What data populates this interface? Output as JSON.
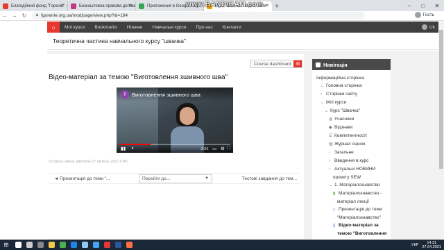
{
  "browser": {
    "tabs": [
      {
        "label": "Благодійний фонд \"Горєніє\" - Б",
        "favicon_color": "#e8372c"
      },
      {
        "label": "Безкоштовна правова допомога",
        "favicon_color": "#c13584"
      },
      {
        "label": "Приложения в Google Play – GE",
        "favicon_color": "#34a853"
      },
      {
        "label": "Курс \"Швачка\": Відео-мате",
        "favicon_color": "#f0a000",
        "active": true
      }
    ],
    "new_tab": "+",
    "url": "fgorenie.org.ua/mod/page/view.php?id=184",
    "profile": "Гость",
    "watermark": "www.BANDICAM.com"
  },
  "navbar": {
    "home_icon": "home-icon",
    "items": [
      "Мої курси",
      "Bookmarks",
      "Новини",
      "Навчальні курси",
      "Про нас",
      "Контакти"
    ],
    "lang": "Uk"
  },
  "page": {
    "header_title": "Теоретична частина навчального курсу \"швачка\"",
    "course_dashboard": "Course dashboard",
    "title": "Відео-матеріал за темою \"Виготовлення зшивного шва\"",
    "video": {
      "channel_letter": "f",
      "title": "Виготовлення зшивного шва",
      "time": "-2:01",
      "progress": 0.28
    },
    "modified": "Останнє зміна: вівторок 27 квітень 2021 5:45",
    "prev_link": "◄ Презентація до теми \"...",
    "jump_placeholder": "Перейти до...",
    "next_link": "Тестові завдання до тем..."
  },
  "navigation": {
    "title": "Навігація",
    "items": [
      {
        "label": "Інформаційна сторінка",
        "icon": "",
        "indent": 0
      },
      {
        "label": "Головна сторінка",
        "icon": "home-icon",
        "indent": 1
      },
      {
        "label": "Сторінки сайту",
        "icon": "chevron-right-icon",
        "indent": 1
      },
      {
        "label": "Мої курси",
        "icon": "chevron-down-icon",
        "indent": 1
      },
      {
        "label": "Курс \"Швачка\"",
        "icon": "chevron-down-icon",
        "indent": 2
      },
      {
        "label": "Учасники",
        "icon": "users-icon",
        "indent": 3
      },
      {
        "label": "Відзнаки",
        "icon": "badge-icon",
        "indent": 3
      },
      {
        "label": "Компетентності",
        "icon": "checkbox-icon",
        "indent": 3
      },
      {
        "label": "Журнал оцінок",
        "icon": "grades-icon",
        "indent": 3
      },
      {
        "label": "Загальне",
        "icon": "chevron-right-icon",
        "indent": 3
      },
      {
        "label": "Введення в курс",
        "icon": "chevron-right-icon",
        "indent": 3
      },
      {
        "label": "Актуальні НОВИНИ",
        "icon": "chevron-right-icon",
        "indent": 3
      },
      {
        "label": "проекту SEW",
        "icon": "",
        "indent": 4
      },
      {
        "label": "1. Матеріалознавство",
        "icon": "chevron-down-icon",
        "indent": 3
      },
      {
        "label": "Матеріалознавство -",
        "icon": "book-icon",
        "indent": 4
      },
      {
        "label": "матеріал лекції",
        "icon": "",
        "indent": 5
      },
      {
        "label": "Презентація до теми",
        "icon": "page-icon",
        "indent": 4
      },
      {
        "label": "\"Матеріалознавство\"",
        "icon": "",
        "indent": 5
      },
      {
        "label": "Відео-матеріал за",
        "icon": "page-icon",
        "indent": 4,
        "bold": true
      },
      {
        "label": "темою \"Виготовлення",
        "icon": "",
        "indent": 5,
        "bold": true
      }
    ]
  },
  "taskbar": {
    "lang": "УКР",
    "time": "14:31",
    "date": "27.04.2021",
    "apps": [
      {
        "name": "search-icon",
        "color": "#ffffff"
      },
      {
        "name": "task-view-icon",
        "color": "#cccccc"
      },
      {
        "name": "settings-icon",
        "color": "#888888"
      },
      {
        "name": "file-explorer-icon",
        "color": "#f2c94c"
      },
      {
        "name": "chrome-icon",
        "color": "#4caf50"
      },
      {
        "name": "edge-icon",
        "color": "#1e88e5"
      },
      {
        "name": "store-icon",
        "color": "#90caf9"
      },
      {
        "name": "photos-icon",
        "color": "#42a5f5"
      },
      {
        "name": "bandicam-icon",
        "color": "#e53935"
      },
      {
        "name": "word-icon",
        "color": "#2b579a"
      },
      {
        "name": "app-icon",
        "color": "#ff7043"
      }
    ]
  }
}
